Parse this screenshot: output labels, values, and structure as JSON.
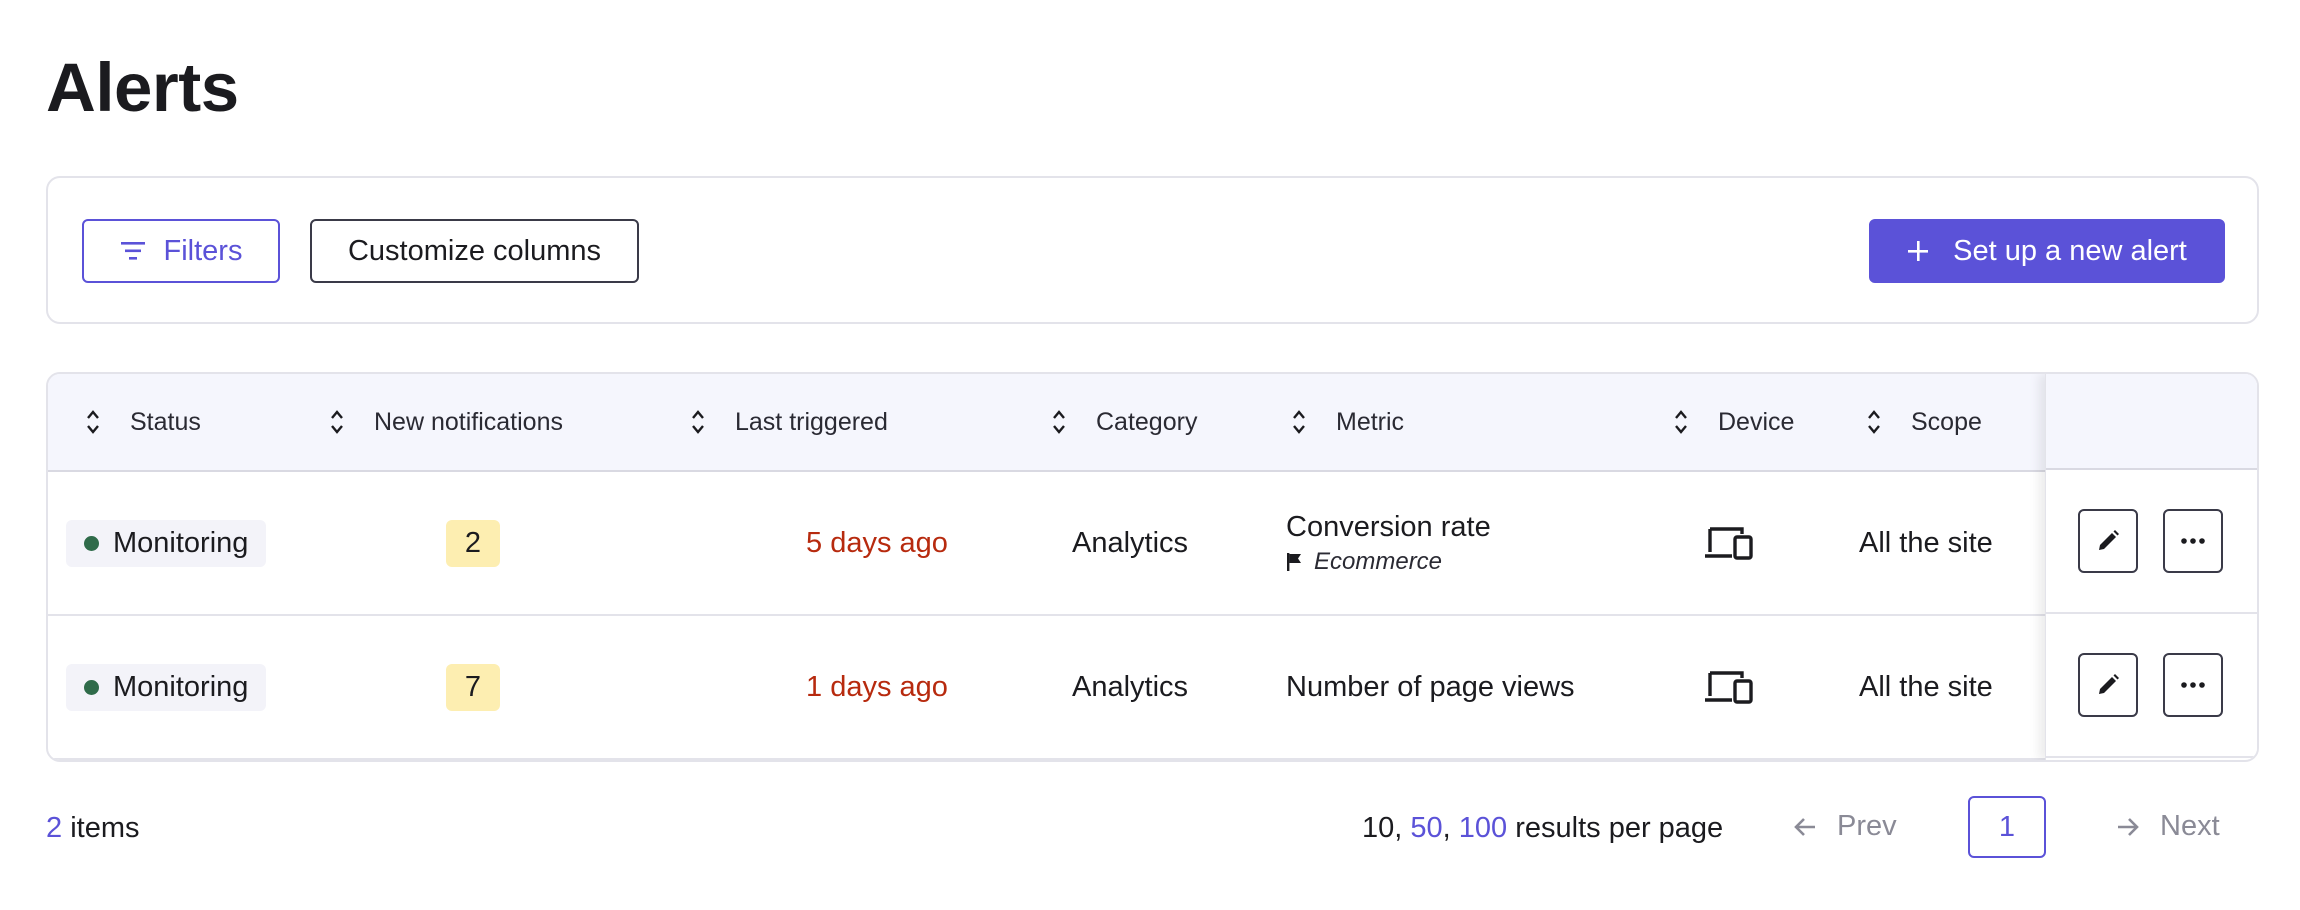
{
  "page": {
    "title": "Alerts"
  },
  "toolbar": {
    "filters_label": "Filters",
    "customize_label": "Customize columns",
    "new_alert_label": "Set up a new alert"
  },
  "table": {
    "columns": [
      {
        "label": "Status"
      },
      {
        "label": "New notifications"
      },
      {
        "label": "Last triggered"
      },
      {
        "label": "Category"
      },
      {
        "label": "Metric"
      },
      {
        "label": "Device"
      },
      {
        "label": "Scope"
      }
    ],
    "rows": [
      {
        "status": "Monitoring",
        "new_notifications": "2",
        "last_triggered": "5 days ago",
        "category": "Analytics",
        "metric": "Conversion rate",
        "metric_sub": "Ecommerce",
        "device_icon": "devices-icon",
        "scope": "All the site"
      },
      {
        "status": "Monitoring",
        "new_notifications": "7",
        "last_triggered": "1 days ago",
        "category": "Analytics",
        "metric": "Number of page views",
        "metric_sub": "",
        "device_icon": "devices-icon",
        "scope": "All the site"
      }
    ]
  },
  "footer": {
    "items_count": "2",
    "items_label": " items",
    "per_page_options": [
      "10",
      "50",
      "100"
    ],
    "per_page_label": " results per page",
    "prev_label": "Prev",
    "current_page": "1",
    "next_label": "Next"
  },
  "colors": {
    "accent": "#5b52d8",
    "danger_text": "#b72a0e",
    "badge_bg": "#fdeeb1",
    "status_dot": "#2f6b4a",
    "header_bg": "#f5f6fd"
  }
}
